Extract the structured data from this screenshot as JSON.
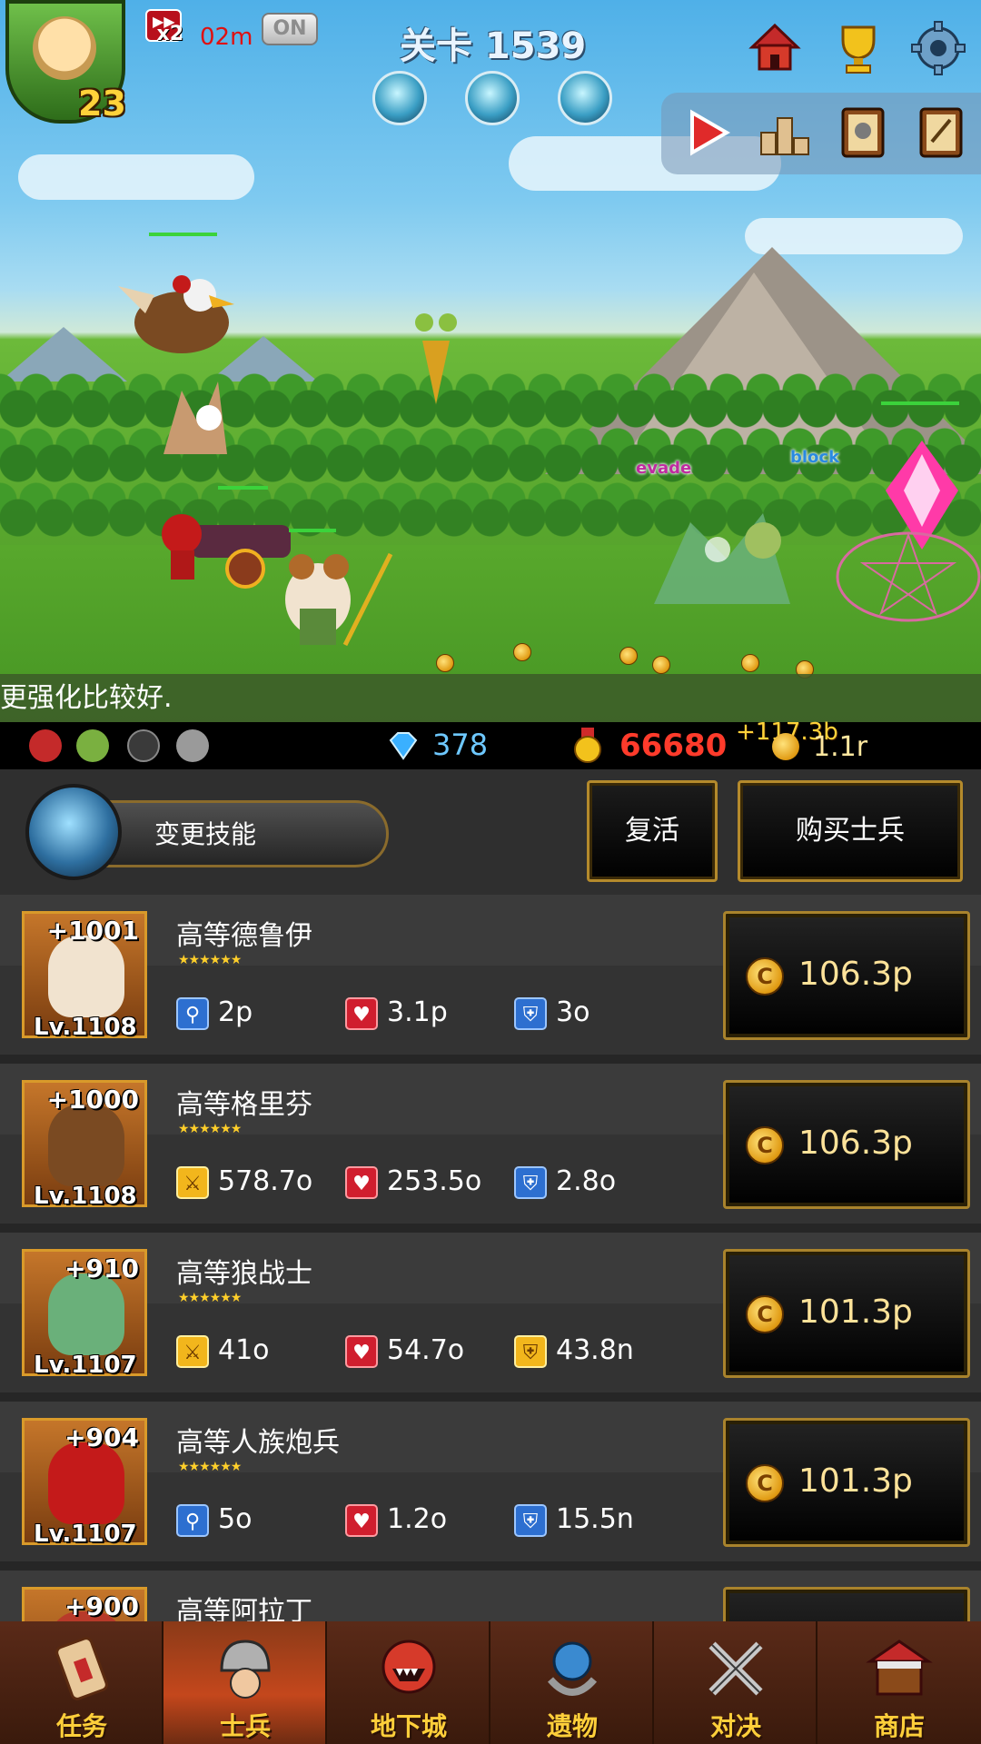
{
  "hud": {
    "player_level": "23",
    "speed_multiplier": "x2",
    "speed_time": "02m",
    "auto_toggle": "ON",
    "stage": "关卡 1539"
  },
  "scene": {
    "floating_text": [
      "evade",
      "block"
    ],
    "hint": "更强化比较好."
  },
  "resources": {
    "gems": "378",
    "gold": "66680",
    "gold_floating": "+117.3b",
    "gold_rate": "1.1r"
  },
  "actions": {
    "change_skill": "变更技能",
    "revive": "复活",
    "buy_soldier": "购买士兵"
  },
  "soldiers": [
    {
      "plus": "+1001",
      "level": "Lv.1108",
      "name": "高等德鲁伊",
      "stars": "★★★★★★",
      "atk": "2p",
      "hp": "3.1p",
      "def": "3o",
      "price": "106.3p",
      "atk_icon": "magic-wand-icon",
      "def_icon": "shield-icon"
    },
    {
      "plus": "+1000",
      "level": "Lv.1108",
      "name": "高等格里芬",
      "stars": "★★★★★★",
      "atk": "578.7o",
      "hp": "253.5o",
      "def": "2.8o",
      "price": "106.3p",
      "atk_icon": "sword-icon",
      "def_icon": "shield-icon"
    },
    {
      "plus": "+910",
      "level": "Lv.1107",
      "name": "高等狼战士",
      "stars": "★★★★★★",
      "atk": "41o",
      "hp": "54.7o",
      "def": "43.8n",
      "price": "101.3p",
      "atk_icon": "sword-icon",
      "def_icon": "shield-icon"
    },
    {
      "plus": "+904",
      "level": "Lv.1107",
      "name": "高等人族炮兵",
      "stars": "★★★★★★",
      "atk": "5o",
      "hp": "1.2o",
      "def": "15.5n",
      "price": "101.3p",
      "atk_icon": "magic-wand-icon",
      "def_icon": "shield-icon"
    },
    {
      "plus": "+900",
      "level": "",
      "name": "高等阿拉丁",
      "stars": "",
      "atk": "",
      "hp": "",
      "def": "",
      "price": "",
      "atk_icon": "",
      "def_icon": ""
    }
  ],
  "nav": [
    {
      "label": "任务"
    },
    {
      "label": "士兵"
    },
    {
      "label": "地下城"
    },
    {
      "label": "遗物"
    },
    {
      "label": "对决"
    },
    {
      "label": "商店"
    }
  ],
  "colors": {
    "gold_text": "#ffe39a",
    "gold_red": "#ff3b2b",
    "gem_blue": "#6ec8ff",
    "nav_active": "#c4471c",
    "frame_gold": "#b48a2c"
  }
}
